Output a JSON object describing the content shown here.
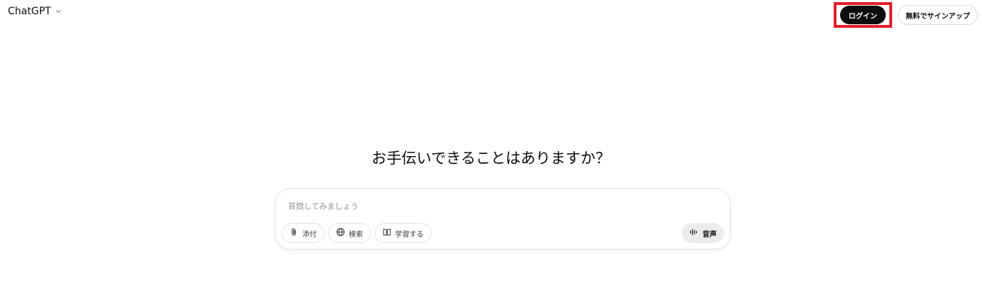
{
  "header": {
    "model_name": "ChatGPT",
    "login_label": "ログイン",
    "signup_label": "無料でサインアップ"
  },
  "main": {
    "heading": "お手伝いできることはありますか？"
  },
  "composer": {
    "placeholder": "質問してみましょう",
    "tools": [
      {
        "icon": "paperclip-icon",
        "label": "添付"
      },
      {
        "icon": "globe-icon",
        "label": "検索"
      },
      {
        "icon": "book-icon",
        "label": "学習する"
      }
    ],
    "voice_label": "音声",
    "voice_icon": "waveform-icon"
  },
  "colors": {
    "highlight_border": "#e21d2b",
    "login_bg": "#0d0d0d",
    "voice_bg": "#ececec"
  }
}
